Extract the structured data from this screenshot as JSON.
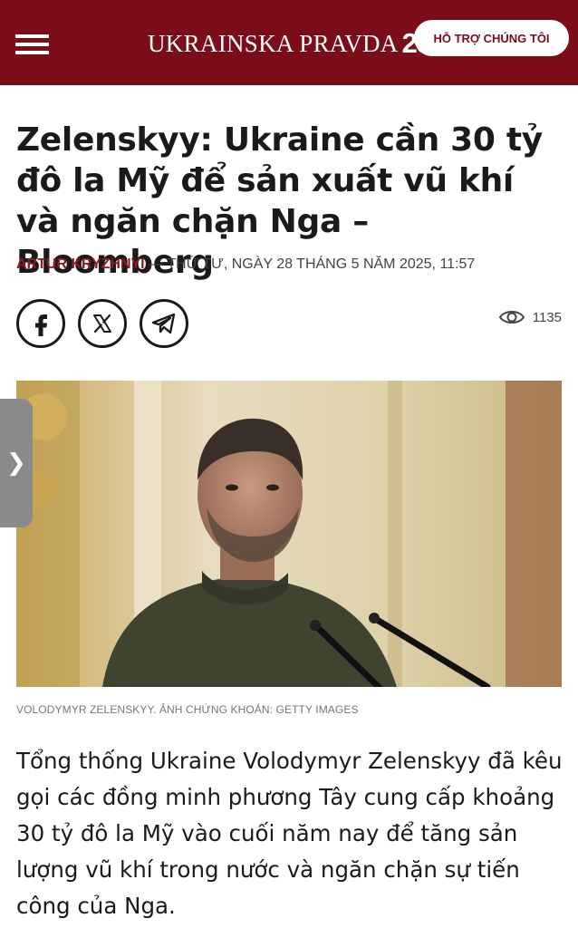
{
  "header": {
    "logo_text": "UKRAINSKA PRAVDA",
    "logo_badge": "25",
    "support_label": "HỖ TRỢ CHÚNG TÔI",
    "menu_icon": "hamburger-menu-icon",
    "background_color": "#7a0d17"
  },
  "article": {
    "title": "Zelenskyy: Ukraine cần 30 tỷ đô la Mỹ để sản xuất vũ khí và ngăn chặn Nga – Bloomberg",
    "author": "ARTUR KRYZHNYI",
    "separator": " — ",
    "date": "THỨ TƯ, NGÀY 28 THÁNG 5 NĂM 2025, 11:57",
    "views": "1135",
    "image_caption": "VOLODYMYR ZELENSKYY. ẢNH CHỨNG KHOÁN: GETTY IMAGES",
    "lead": "Tổng thống Ukraine Volodymyr Zelenskyy đã kêu gọi các đồng minh phương Tây cung cấp khoảng 30 tỷ đô la Mỹ vào cuối năm nay để tăng sản lượng vũ khí trong nước và ngăn chặn sự tiến công của Nga."
  },
  "share": {
    "icons": [
      "facebook-icon",
      "x-icon",
      "telegram-icon"
    ]
  },
  "side_tab": {
    "glyph": "❯"
  },
  "colors": {
    "accent": "#8b1a23",
    "text": "#1a1a1a",
    "meta": "#444444",
    "caption": "#777777"
  }
}
